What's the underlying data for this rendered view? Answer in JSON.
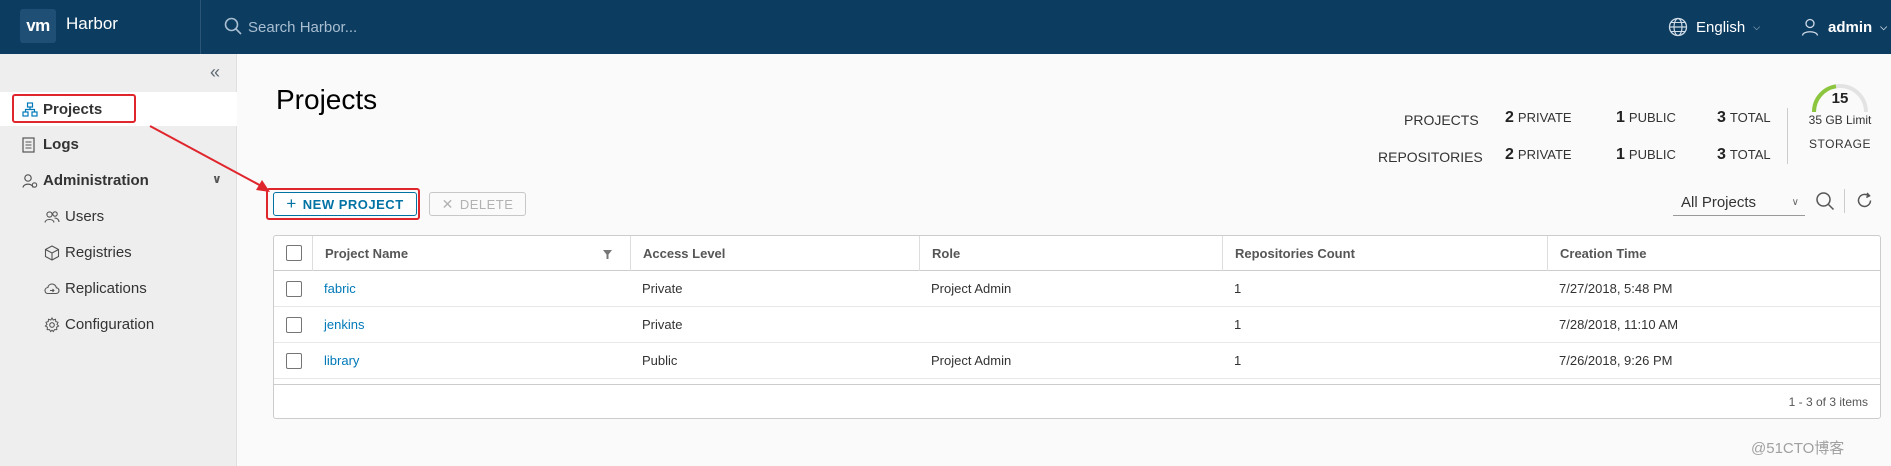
{
  "header": {
    "logo_text": "vm",
    "app_title": "Harbor",
    "search_placeholder": "Search Harbor...",
    "language": "English",
    "user": "admin"
  },
  "sidebar": {
    "items": [
      {
        "label": "Projects",
        "icon": "projects-icon"
      },
      {
        "label": "Logs",
        "icon": "logs-icon"
      },
      {
        "label": "Administration",
        "icon": "administration-icon"
      },
      {
        "label": "Users",
        "icon": "users-icon"
      },
      {
        "label": "Registries",
        "icon": "registries-icon"
      },
      {
        "label": "Replications",
        "icon": "replications-icon"
      },
      {
        "label": "Configuration",
        "icon": "gear-icon"
      }
    ]
  },
  "main": {
    "title": "Projects",
    "stats": {
      "projects_label": "PROJECTS",
      "repositories_label": "REPOSITORIES",
      "projects": {
        "private_num": "2",
        "private_label": "PRIVATE",
        "public_num": "1",
        "public_label": "PUBLIC",
        "total_num": "3",
        "total_label": "TOTAL"
      },
      "repositories": {
        "private_num": "2",
        "private_label": "PRIVATE",
        "public_num": "1",
        "public_label": "PUBLIC",
        "total_num": "3",
        "total_label": "TOTAL"
      },
      "storage_value": "15",
      "storage_limit": "35 GB Limit",
      "storage_label": "STORAGE"
    },
    "toolbar": {
      "new_project": "NEW PROJECT",
      "delete": "DELETE",
      "filter_selected": "All Projects"
    },
    "table": {
      "columns": [
        "Project Name",
        "Access Level",
        "Role",
        "Repositories Count",
        "Creation Time"
      ],
      "rows": [
        {
          "name": "fabric",
          "access": "Private",
          "role": "Project Admin",
          "repos": "1",
          "created": "7/27/2018, 5:48 PM"
        },
        {
          "name": "jenkins",
          "access": "Private",
          "role": "",
          "repos": "1",
          "created": "7/28/2018, 11:10 AM"
        },
        {
          "name": "library",
          "access": "Public",
          "role": "Project Admin",
          "repos": "1",
          "created": "7/26/2018, 9:26 PM"
        }
      ],
      "footer": "1 - 3 of 3 items"
    }
  },
  "watermark": "@51CTO博客",
  "colors": {
    "header_bg": "#0d3c61",
    "accent": "#0072a3",
    "link": "#0079b8",
    "annotation_red": "#e0262d",
    "gauge_green": "#8cc63f"
  }
}
